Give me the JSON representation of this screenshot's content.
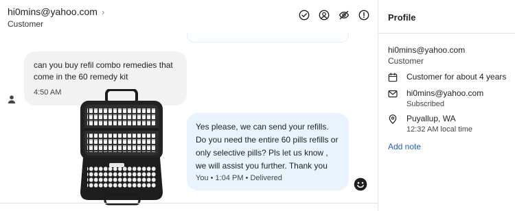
{
  "header": {
    "contact_email": "hi0mins@yahoo.com",
    "contact_role": "Customer",
    "chevron": "›",
    "icons": [
      "check-circle-icon",
      "user-circle-icon",
      "eye-off-icon",
      "alert-circle-icon"
    ]
  },
  "messages": [
    {
      "direction": "incoming",
      "text": "can you buy refil combo remedies that come in the 60 remedy kit",
      "time": "4:50 AM"
    },
    {
      "direction": "outgoing",
      "text": "Yes please, we can send your refills. Do you need the entire 60 pills refills or only selective pills? Pls let us know , we will assist you further. Thank you",
      "meta": "You • 1:04 PM • Delivered"
    }
  ],
  "profile": {
    "title": "Profile",
    "email": "hi0mins@yahoo.com",
    "role": "Customer",
    "customer_since": "Customer for about 4 years",
    "subscription_email": "hi0mins@yahoo.com",
    "subscription_status": "Subscribed",
    "location": "Puyallup, WA",
    "local_time": "12:32 AM local time",
    "add_note_label": "Add note"
  },
  "colors": {
    "incoming_bubble": "#f2f2f2",
    "outgoing_bubble": "#e8f3fd",
    "link": "#1f5fbf"
  }
}
